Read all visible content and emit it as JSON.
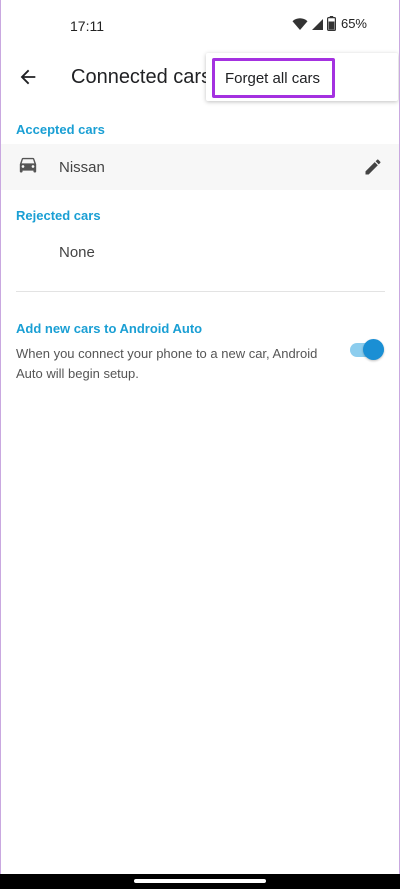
{
  "status_bar": {
    "time": "17:11",
    "battery": "65%",
    "icons": [
      "wifi-icon",
      "signal-icon",
      "battery-icon"
    ]
  },
  "app_bar": {
    "title": "Connected cars",
    "back_icon": "arrow-back-icon"
  },
  "overflow_menu": {
    "items": [
      {
        "label": "Forget all cars"
      }
    ],
    "highlight_color": "#a431e0"
  },
  "accepted": {
    "label": "Accepted cars",
    "cars": [
      {
        "name": "Nissan",
        "icon": "car-icon",
        "action_icon": "edit-icon"
      }
    ]
  },
  "rejected": {
    "label": "Rejected cars",
    "empty_text": "None"
  },
  "add_new": {
    "title": "Add new cars to Android Auto",
    "description": "When you connect your phone to a new car, Android Auto will begin setup.",
    "enabled": true
  },
  "colors": {
    "accent": "#1a9fd4",
    "toggle_thumb": "#1a8fd4",
    "toggle_track": "#8ccdee"
  }
}
